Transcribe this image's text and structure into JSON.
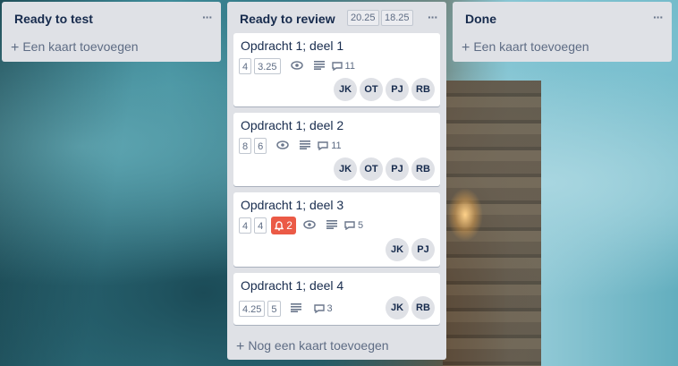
{
  "lists": [
    {
      "title": "Ready to test",
      "menu": "···",
      "add_card": "Een kaart toevoegen"
    },
    {
      "title": "Ready to review",
      "menu": "···",
      "header_badges": [
        "20.25",
        "18.25"
      ],
      "add_card": "Nog een kaart toevoegen",
      "cards": [
        {
          "title": "Opdracht 1; deel 1",
          "badges": [
            "4",
            "3.25"
          ],
          "comments": "11",
          "members": [
            "JK",
            "OT",
            "PJ",
            "RB"
          ]
        },
        {
          "title": "Opdracht 1; deel 2",
          "badges": [
            "8",
            "6"
          ],
          "comments": "11",
          "members": [
            "JK",
            "OT",
            "PJ",
            "RB"
          ]
        },
        {
          "title": "Opdracht 1; deel 3",
          "badges": [
            "4",
            "4"
          ],
          "alert": "2",
          "comments": "5",
          "members": [
            "JK",
            "PJ"
          ]
        },
        {
          "title": "Opdracht 1; deel 4",
          "badges": [
            "4.25",
            "5"
          ],
          "comments": "3",
          "members": [
            "JK",
            "RB"
          ]
        }
      ]
    },
    {
      "title": "Done",
      "menu": "···",
      "add_card": "Een kaart toevoegen"
    }
  ],
  "colors": {
    "list_bg": "#dfe1e6",
    "alert": "#eb5a46"
  }
}
